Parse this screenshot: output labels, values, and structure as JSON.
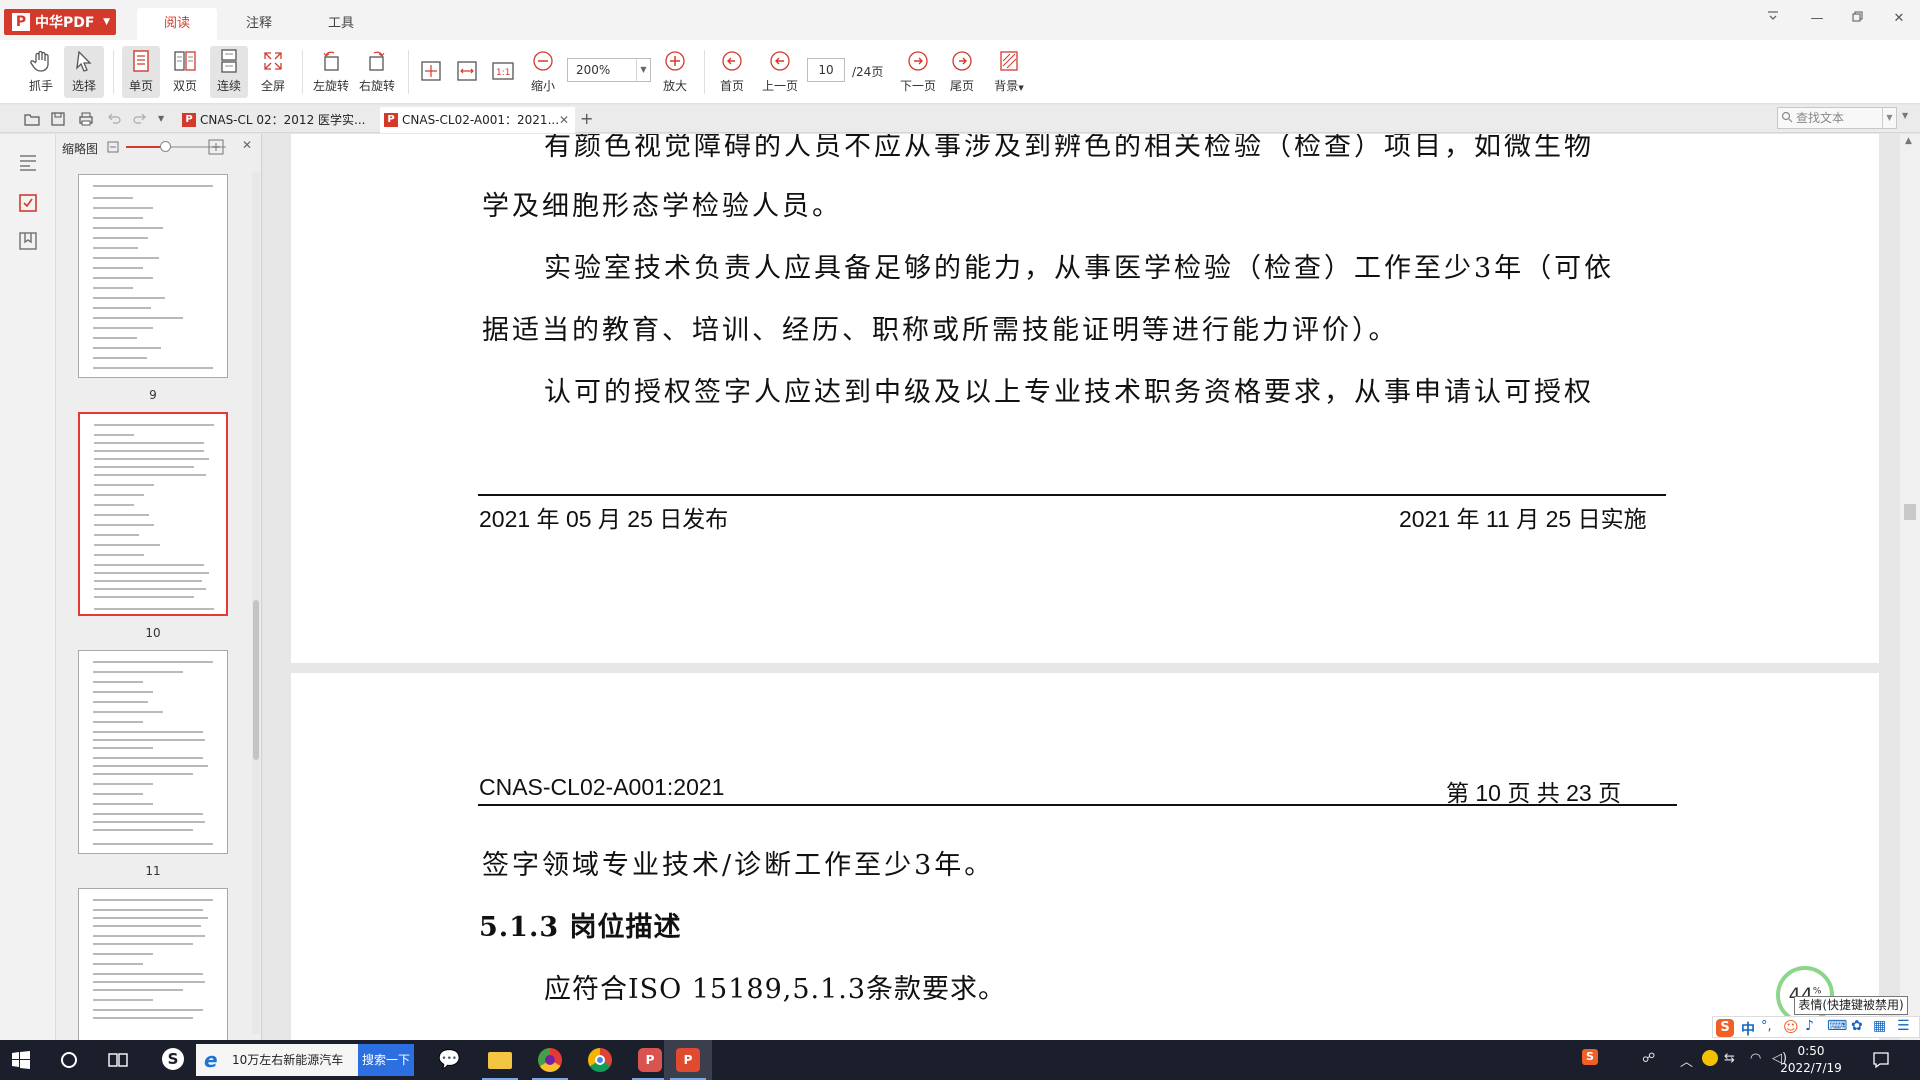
{
  "app": {
    "brand": "中华PDF",
    "main_tabs": [
      {
        "label": "阅读",
        "active": true
      },
      {
        "label": "注释",
        "active": false
      },
      {
        "label": "工具",
        "active": false
      }
    ],
    "accent_color": "#d33a2c"
  },
  "toolbar": {
    "hand": "抓手",
    "select": "选择",
    "single_page": "单页",
    "double_page": "双页",
    "continuous": "连续",
    "fullscreen": "全屏",
    "rotate_left": "左旋转",
    "rotate_right": "右旋转",
    "zoom_out": "缩小",
    "zoom_value": "200%",
    "zoom_in": "放大",
    "first_page": "首页",
    "prev_page": "上一页",
    "current_page": "10",
    "total_pages": "/24页",
    "next_page": "下一页",
    "last_page": "尾页",
    "background": "背景"
  },
  "doc_tabs": [
    {
      "label": "CNAS-CL 02：2012 医学实...",
      "active": false
    },
    {
      "label": "CNAS-CL02-A001：2021...",
      "active": true
    }
  ],
  "search": {
    "placeholder": "查找文本"
  },
  "thumbnails": {
    "title": "缩略图",
    "pages": [
      {
        "label": "9",
        "selected": false
      },
      {
        "label": "10",
        "selected": true
      },
      {
        "label": "11",
        "selected": false
      },
      {
        "label": "",
        "selected": false
      }
    ]
  },
  "document": {
    "upper_page": {
      "lines": [
        "有颜色视觉障碍的人员不应从事涉及到辨色的相关检验（检查）项目，如微生物",
        "学及细胞形态学检验人员。",
        "实验室技术负责人应具备足够的能力，从事医学检验（检查）工作至少3年（可依",
        "据适当的教育、培训、经历、职称或所需技能证明等进行能力评价）。",
        "认可的授权签字人应达到中级及以上专业技术职务资格要求，从事申请认可授权"
      ],
      "footer_left": "2021 年 05 月 25 日发布",
      "footer_right": "2021 年 11 月 25 日实施"
    },
    "lower_page": {
      "header_left": "CNAS-CL02-A001:2021",
      "header_right": "第  10  页  共  23  页",
      "lines": [
        "签字领域专业技术/诊断工作至少3年。",
        "5.1.3  岗位描述",
        "应符合ISO 15189,5.1.3条款要求。"
      ]
    }
  },
  "overlay": {
    "gauge_value": "44",
    "gauge_unit": "%",
    "ime_tooltip": "表情(快捷键被禁用)",
    "ime_mode": "中"
  },
  "taskbar": {
    "search_text": "10万左右新能源汽车",
    "search_button": "搜索一下",
    "time": "0:50",
    "date": "2022/7/19"
  }
}
